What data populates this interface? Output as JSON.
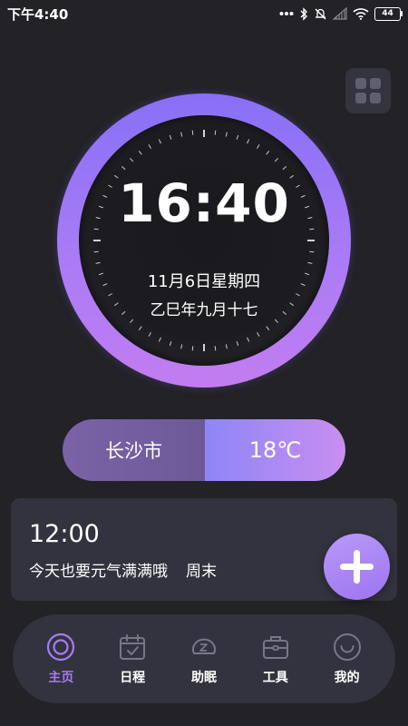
{
  "status_bar": {
    "time": "下午4:40",
    "battery": "44",
    "icons": [
      "dots-icon",
      "bluetooth-icon",
      "mute-icon",
      "signal-icon",
      "wifi-icon",
      "battery-icon"
    ]
  },
  "top_right": {
    "icon": "grid-menu-icon"
  },
  "clock": {
    "time": "16:40",
    "date": "11月6日星期四",
    "lunar": "乙巳年九月十七"
  },
  "weather": {
    "city": "长沙市",
    "temperature": "18℃"
  },
  "reminder": {
    "time": "12:00",
    "message": "今天也要元气满满哦",
    "tag": "周末",
    "add_icon": "plus-icon"
  },
  "nav": {
    "items": [
      {
        "label": "主页",
        "icon": "home-target-icon",
        "active": true
      },
      {
        "label": "日程",
        "icon": "calendar-icon",
        "active": false
      },
      {
        "label": "助眠",
        "icon": "sleep-icon",
        "active": false
      },
      {
        "label": "工具",
        "icon": "toolbox-icon",
        "active": false
      },
      {
        "label": "我的",
        "icon": "profile-smile-icon",
        "active": false
      }
    ]
  },
  "colors": {
    "background": "#222227",
    "card": "#33333f",
    "accent": "#a57cf3",
    "ring_start": "#8770f6",
    "ring_end": "#c27df0"
  }
}
